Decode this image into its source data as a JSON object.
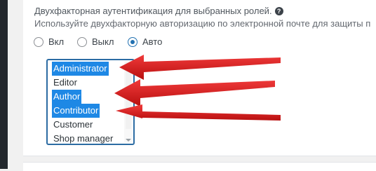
{
  "section": {
    "title": "Двухфакторная аутентификация для выбранных ролей.",
    "help_icon": "?",
    "description": "Используйте двухфакторную авторизацию по электронной почте для защиты п"
  },
  "radio_options": [
    {
      "label": "Вкл",
      "checked": false
    },
    {
      "label": "Выкл",
      "checked": false
    },
    {
      "label": "Авто",
      "checked": true
    }
  ],
  "roles_list": [
    {
      "label": "Administrator",
      "selected": true
    },
    {
      "label": "Editor",
      "selected": false
    },
    {
      "label": "Author",
      "selected": true
    },
    {
      "label": "Contributor",
      "selected": true
    },
    {
      "label": "Customer",
      "selected": false
    },
    {
      "label": "Shop manager",
      "selected": false
    }
  ],
  "colors": {
    "selection": "#1e88e5",
    "accent": "#2271b1",
    "annotation_arrow": "#d81c1c"
  },
  "annotations": {
    "arrow_targets": [
      "Administrator",
      "Author",
      "Contributor"
    ]
  }
}
